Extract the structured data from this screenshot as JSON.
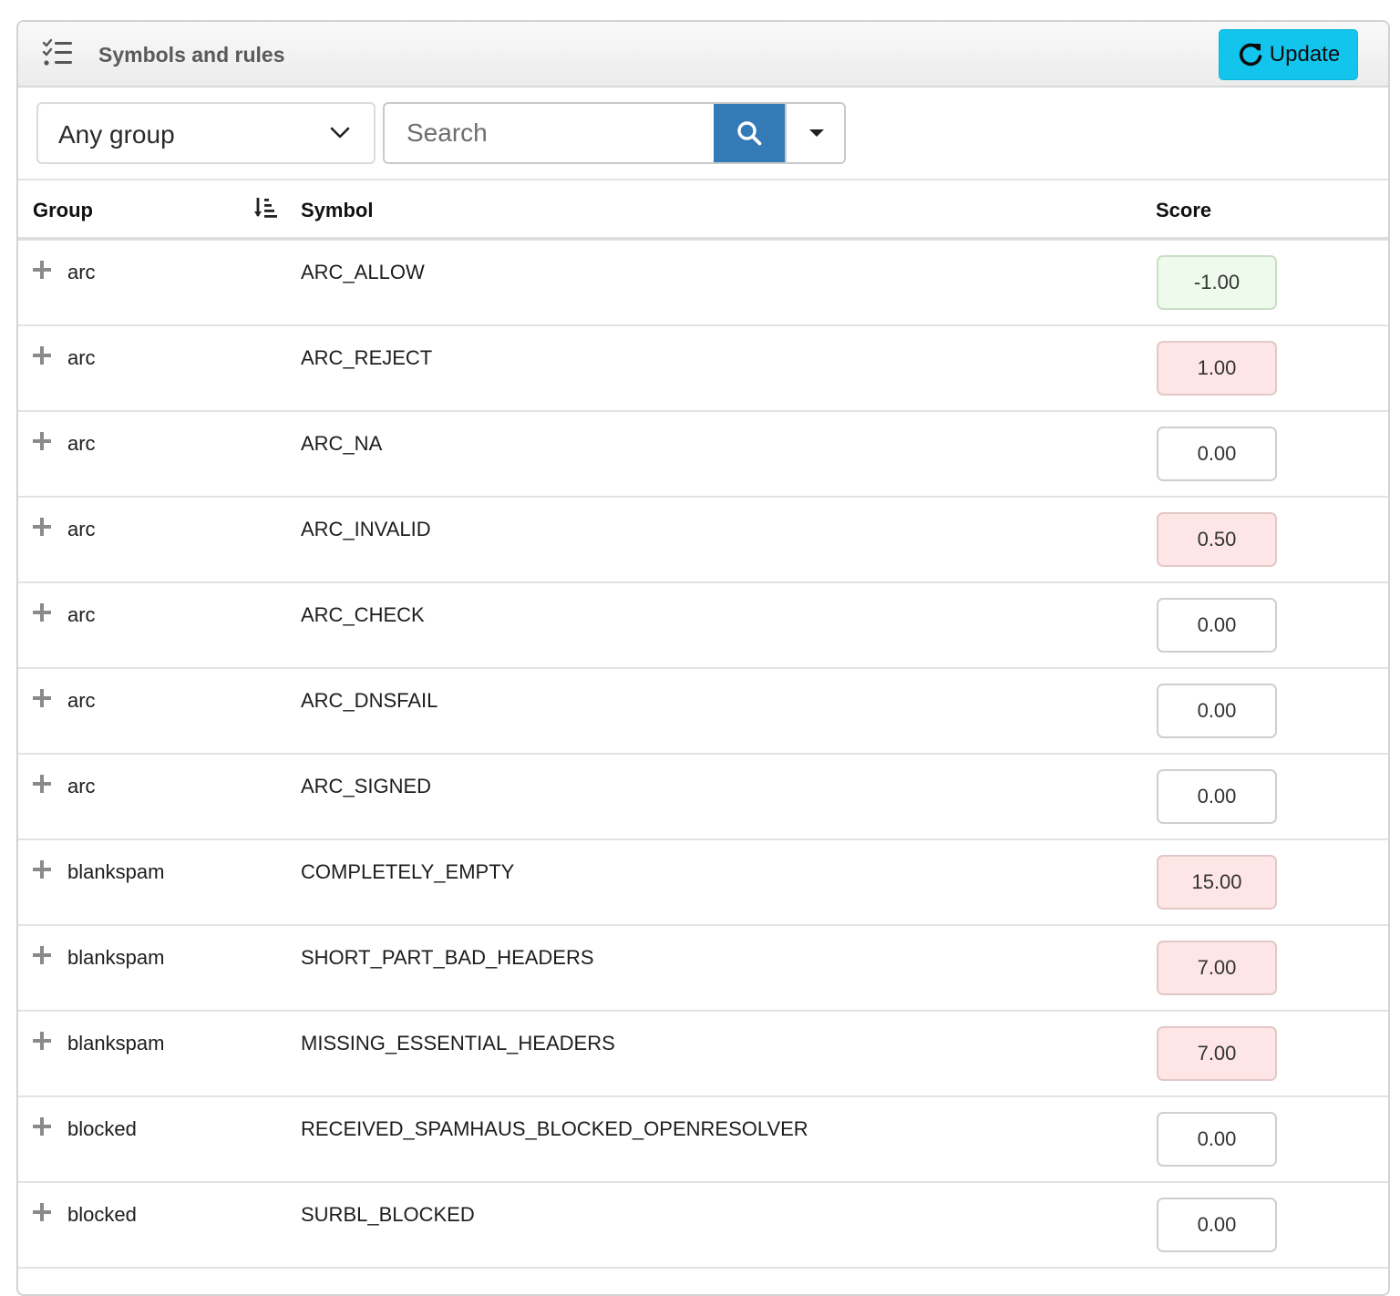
{
  "header": {
    "title": "Symbols and rules",
    "icon": "checklist-icon",
    "update_label": "Update"
  },
  "toolbar": {
    "group_filter_value": "Any group",
    "search_placeholder": "Search"
  },
  "table": {
    "columns": [
      "Group",
      "Symbol",
      "Score"
    ],
    "rows": [
      {
        "group": "arc",
        "symbol": "ARC_ALLOW",
        "score": "-1.00",
        "score_bg": "#eefaeb",
        "score_border": "#c9dfc4"
      },
      {
        "group": "arc",
        "symbol": "ARC_REJECT",
        "score": "1.00",
        "score_bg": "#fde6e5",
        "score_border": "#e3c8c7"
      },
      {
        "group": "arc",
        "symbol": "ARC_NA",
        "score": "0.00",
        "score_bg": "#ffffff",
        "score_border": "#cfcfcf"
      },
      {
        "group": "arc",
        "symbol": "ARC_INVALID",
        "score": "0.50",
        "score_bg": "#fde6e5",
        "score_border": "#e3c8c7"
      },
      {
        "group": "arc",
        "symbol": "ARC_CHECK",
        "score": "0.00",
        "score_bg": "#ffffff",
        "score_border": "#cfcfcf"
      },
      {
        "group": "arc",
        "symbol": "ARC_DNSFAIL",
        "score": "0.00",
        "score_bg": "#ffffff",
        "score_border": "#cfcfcf"
      },
      {
        "group": "arc",
        "symbol": "ARC_SIGNED",
        "score": "0.00",
        "score_bg": "#ffffff",
        "score_border": "#cfcfcf"
      },
      {
        "group": "blankspam",
        "symbol": "COMPLETELY_EMPTY",
        "score": "15.00",
        "score_bg": "#fde6e5",
        "score_border": "#e3c8c7"
      },
      {
        "group": "blankspam",
        "symbol": "SHORT_PART_BAD_HEADERS",
        "score": "7.00",
        "score_bg": "#fde6e5",
        "score_border": "#e3c8c7"
      },
      {
        "group": "blankspam",
        "symbol": "MISSING_ESSENTIAL_HEADERS",
        "score": "7.00",
        "score_bg": "#fde6e5",
        "score_border": "#e3c8c7"
      },
      {
        "group": "blocked",
        "symbol": "RECEIVED_SPAMHAUS_BLOCKED_OPENRESOLVER",
        "score": "0.00",
        "score_bg": "#ffffff",
        "score_border": "#cfcfcf"
      },
      {
        "group": "blocked",
        "symbol": "SURBL_BLOCKED",
        "score": "0.00",
        "score_bg": "#ffffff",
        "score_border": "#cfcfcf"
      }
    ]
  }
}
